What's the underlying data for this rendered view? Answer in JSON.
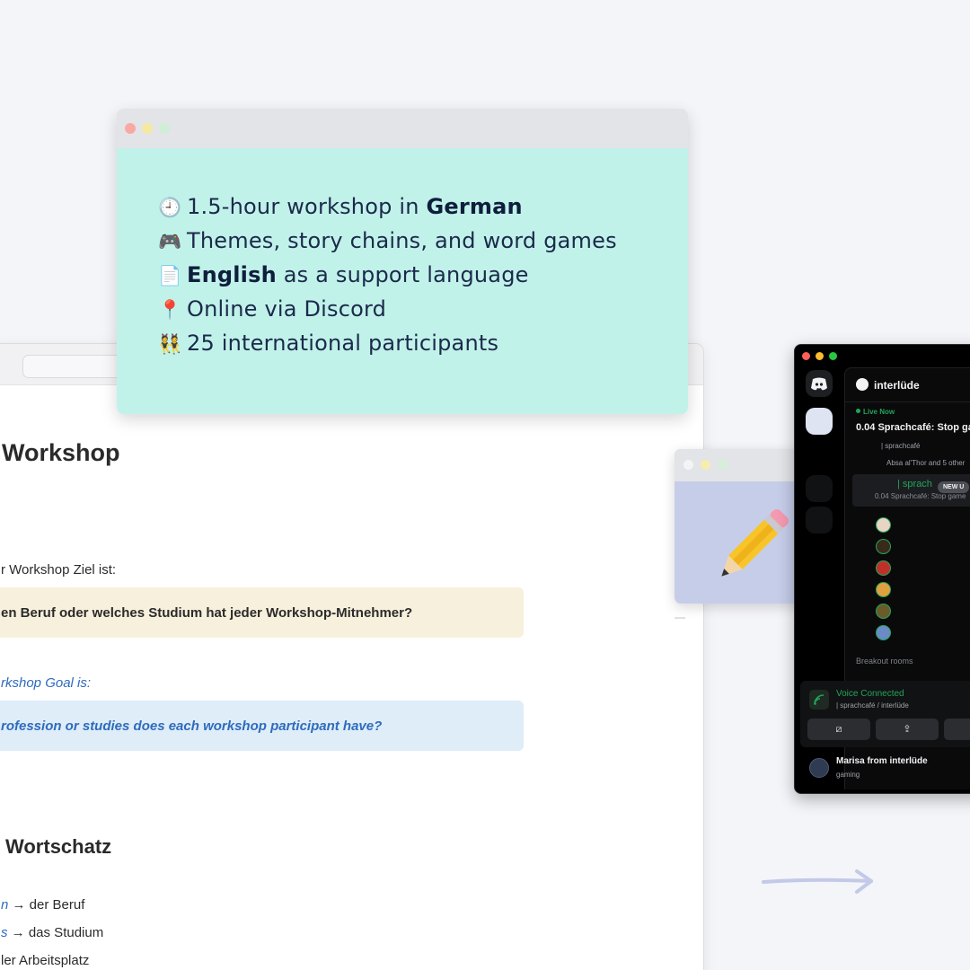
{
  "doc": {
    "heading": "Workshop",
    "goal_de_label": "r Workshop Ziel ist:",
    "goal_de": "en Beruf oder welches Studium hat jeder Workshop-Mitnehmer?",
    "goal_en_label": "rkshop Goal is:",
    "goal_en": "rofession or studies does each workshop participant have?",
    "vocab_heading": "Wortschatz",
    "vocab": [
      {
        "hl": "n",
        "rest": " → der Beruf"
      },
      {
        "hl": "s",
        "rest": " → das Studium"
      },
      {
        "hl": "",
        "rest": "ler Arbeitsplatz"
      }
    ]
  },
  "info": {
    "items": [
      {
        "icon": "🕘",
        "pre": "1.5-hour workshop in ",
        "bold": "German",
        "post": ""
      },
      {
        "icon": "🎮",
        "pre": "Themes, story chains, and word games",
        "bold": "",
        "post": ""
      },
      {
        "icon": "📄",
        "pre": "",
        "bold": "English",
        "post": " as a support language"
      },
      {
        "icon": "📍",
        "pre": "Online via Discord",
        "bold": "",
        "post": ""
      },
      {
        "icon": "👯",
        "pre": "25 international participants",
        "bold": "",
        "post": ""
      }
    ]
  },
  "discord": {
    "server_name": "interlüde",
    "live_label": "Live Now",
    "event_title": "0.04 Sprachcafé: Stop ga",
    "event_channel": "| sprachcafé",
    "event_attendees": "Absa al'Thor and 5 other",
    "channel_name": "| sprach",
    "channel_sub": "0.04 Sprachcafé: Stop game",
    "new_badge": "NEW U",
    "breakout": "Breakout rooms",
    "voice_title": "Voice Connected",
    "voice_sub": "| sprachcafé / interlüde",
    "user_name": "Marisa from interlüde",
    "user_status": "gaming"
  },
  "colors": {
    "info_bg": "#c1f2ea",
    "pencil_bg": "#c6cde9",
    "callout_yellow": "#f7f0dc",
    "callout_blue": "#deedf8",
    "link_blue": "#2f6bbd",
    "discord_green": "#23a55a"
  }
}
